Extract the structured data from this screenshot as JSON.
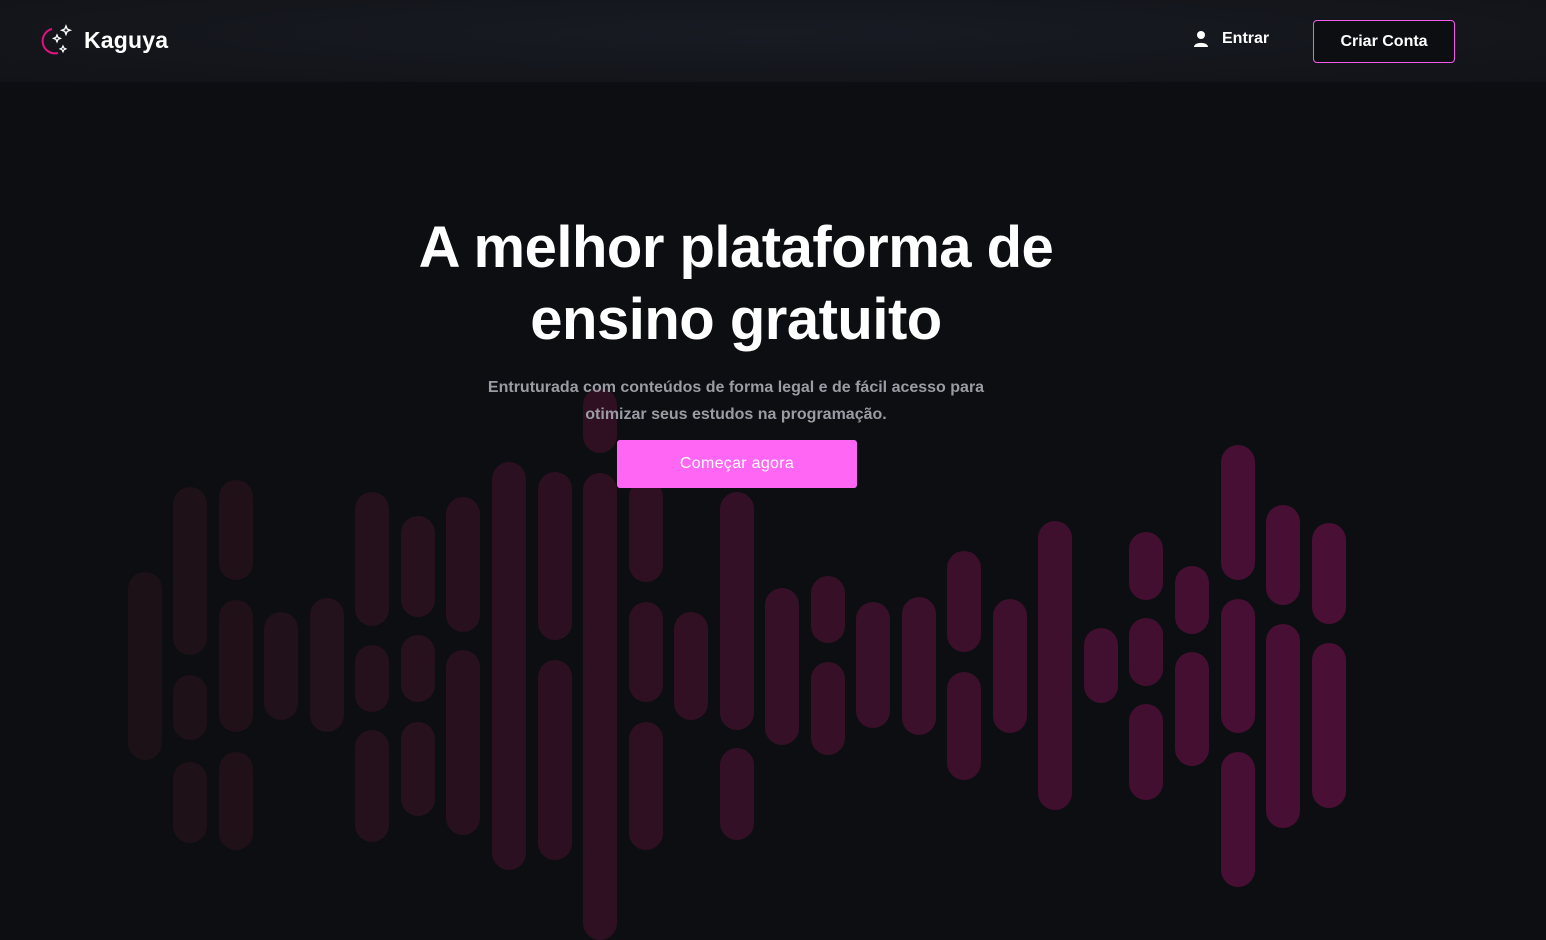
{
  "colors": {
    "background": "#0d0e12",
    "navbar": "#14161c",
    "accent": "#ff66f4",
    "accent_border": "#f25bec",
    "wave_light": "#1c1116",
    "wave_strong": "#4a0f35"
  },
  "header": {
    "brand_name": "Kaguya",
    "brand_icon": "moon-stars-icon",
    "login_icon": "user-icon",
    "login_label": "Entrar",
    "signup_label": "Criar Conta"
  },
  "hero": {
    "title_line1": "A melhor plataforma de",
    "title_line2": "ensino gratuito",
    "subtitle_line1": "Entruturada com conteúdos de forma legal e de fácil acesso para",
    "subtitle_line2": "otimizar seus estudos na programação.",
    "cta_label": "Começar agora"
  }
}
